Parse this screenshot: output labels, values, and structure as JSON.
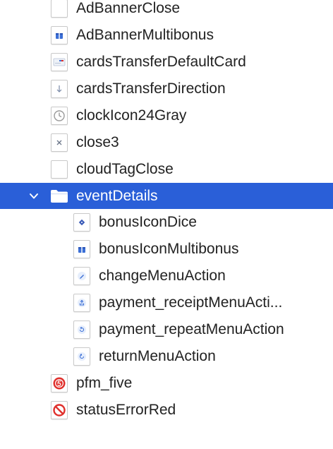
{
  "tree": {
    "items": [
      {
        "label": "AdBannerClose",
        "icon": "blank-asset-icon"
      },
      {
        "label": "AdBannerMultibonus",
        "icon": "gift-icon"
      },
      {
        "label": "cardsTransferDefaultCard",
        "icon": "card-icon"
      },
      {
        "label": "cardsTransferDirection",
        "icon": "arrow-down-icon"
      },
      {
        "label": "clockIcon24Gray",
        "icon": "clock-icon"
      },
      {
        "label": "close3",
        "icon": "close-icon"
      },
      {
        "label": "cloudTagClose",
        "icon": "blank-asset-icon"
      },
      {
        "label": "eventDetails",
        "icon": "folder-icon",
        "expanded": true,
        "selected": true
      },
      {
        "label": "bonusIconDice",
        "icon": "dice-icon"
      },
      {
        "label": "bonusIconMultibonus",
        "icon": "gift-icon"
      },
      {
        "label": "changeMenuAction",
        "icon": "pencil-icon"
      },
      {
        "label": "payment_receiptMenuActi...",
        "icon": "share-icon"
      },
      {
        "label": "payment_repeatMenuAction",
        "icon": "repeat-icon"
      },
      {
        "label": "returnMenuAction",
        "icon": "return-icon"
      },
      {
        "label": "pfm_five",
        "icon": "five-badge-icon"
      },
      {
        "label": "statusErrorRed",
        "icon": "error-icon"
      }
    ]
  },
  "colors": {
    "selection": "#2a5fd8",
    "accent": "#3b6fd6",
    "error": "#e0302c"
  }
}
